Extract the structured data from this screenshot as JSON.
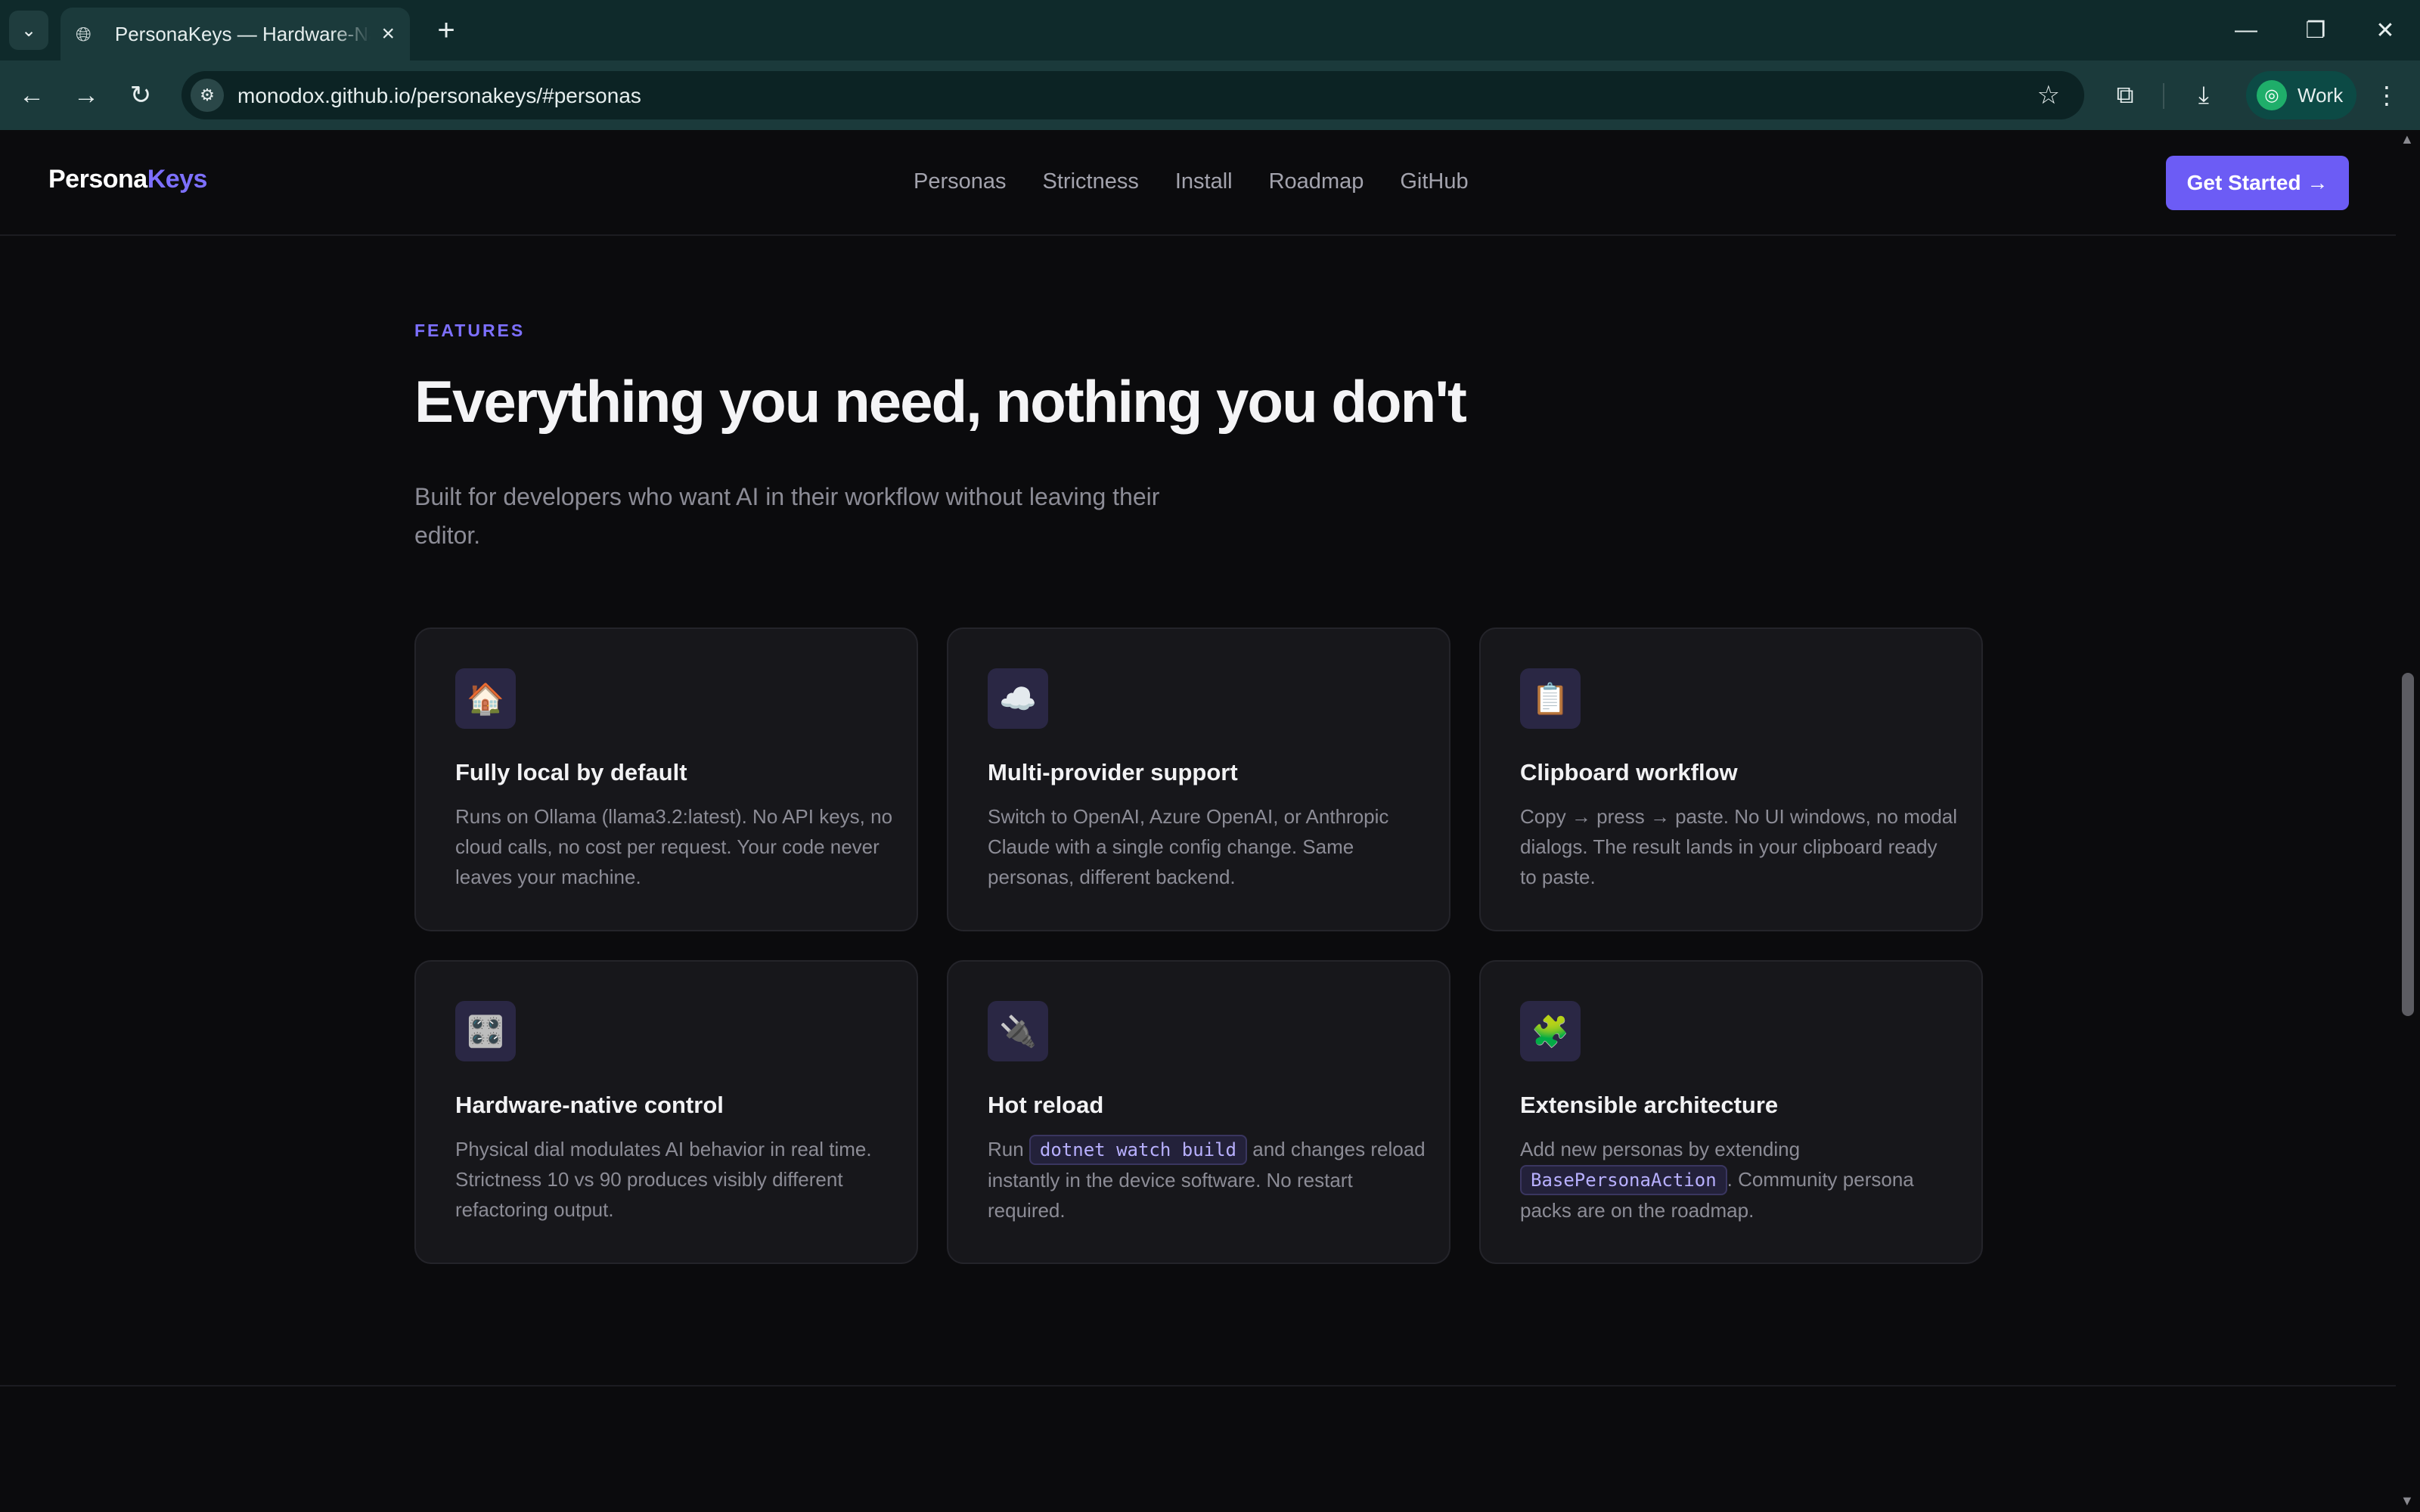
{
  "browser": {
    "tab_title": "PersonaKeys — Hardware-Native",
    "url": "monodox.github.io/personakeys/#personas",
    "profile_label": "Work"
  },
  "site": {
    "logo_main": "Persona",
    "logo_accent": "Keys",
    "nav": [
      "Personas",
      "Strictness",
      "Install",
      "Roadmap",
      "GitHub"
    ],
    "cta": "Get Started →"
  },
  "features": {
    "eyebrow": "FEATURES",
    "heading": "Everything you need, nothing you don't",
    "lede": "Built for developers who want AI in their workflow without leaving their editor.",
    "cards": [
      {
        "icon": "🏠",
        "icon_name": "house-icon",
        "title": "Fully local by default",
        "desc": "Runs on Ollama (llama3.2:latest). No API keys, no cloud calls, no cost per request. Your code never leaves your machine."
      },
      {
        "icon": "☁️",
        "icon_name": "cloud-icon",
        "title": "Multi-provider support",
        "desc": "Switch to OpenAI, Azure OpenAI, or Anthropic Claude with a single config change. Same personas, different backend."
      },
      {
        "icon": "📋",
        "icon_name": "clipboard-icon",
        "title": "Clipboard workflow",
        "desc": "Copy → press → paste. No UI windows, no modal dialogs. The result lands in your clipboard ready to paste."
      },
      {
        "icon": "🎛️",
        "icon_name": "control-knobs-icon",
        "title": "Hardware-native control",
        "desc": "Physical dial modulates AI behavior in real time. Strictness 10 vs 90 produces visibly different refactoring output."
      },
      {
        "icon": "🔌",
        "icon_name": "plug-icon",
        "title": "Hot reload",
        "desc_pre": "Run ",
        "code": "dotnet watch build",
        "desc_post": " and changes reload instantly in the device software. No restart required."
      },
      {
        "icon": "🧩",
        "icon_name": "puzzle-icon",
        "title": "Extensible architecture",
        "desc_pre": "Add new personas by extending ",
        "code": "BasePersonaAction",
        "desc_post": ". Community persona packs are on the roadmap."
      }
    ]
  }
}
